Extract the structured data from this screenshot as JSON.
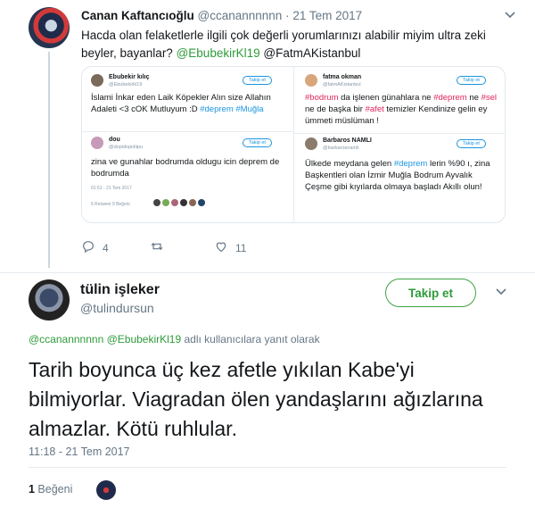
{
  "top_tweet": {
    "author_name": "Canan Kaftancıoğlu",
    "author_handle": "@ccanannnnnn",
    "date": "· 21 Tem 2017",
    "text_1": "Hacda olan felaketlerle ilgili çok değerli yorumlarınızı alabilir miyim ultra zeki beyler, bayanlar?",
    "mention_1": "@EbubekirKl19",
    "mention_2": "@FatmAKistanbul",
    "replies": "4",
    "likes": "11"
  },
  "embedded": {
    "card1": {
      "name": "Ebubekir kılıç",
      "handle": "@Ebubekirkl19",
      "follow": "Takip et",
      "text": "İslami İnkar eden Laik Köpekler Alın size Allahın Adaleti <3 cOK Mutluyum :D",
      "tags": "#deprem #Muğla"
    },
    "card2": {
      "name": "dou",
      "handle": "@dopidopidiipu",
      "follow": "Takip et",
      "text": "zina ve gunahlar bodrumda oldugu icin deprem de bodrumda",
      "meta": "01:51 - 21 Tem 2017",
      "stats": "6 Retweet   9 Beğeni"
    },
    "card3": {
      "name": "fatma okman",
      "handle": "@fatmAKistanbul",
      "follow": "Takip et",
      "tag1": "#bodrum",
      "t1": " da işlenen günahlara ne ",
      "tag2": "#deprem",
      "t2": " ne ",
      "tag3": "#sel",
      "t3": " ne de başka bir ",
      "tag4": "#afet",
      "t4": " temizler Kendinize gelin ey ümmeti müslüman !"
    },
    "card4": {
      "name": "Barbaros NAMLI",
      "handle": "@barbarosnamli",
      "follow": "Takip et",
      "t1": "Ülkede meydana gelen ",
      "tag": "#deprem",
      "t2": " lerin %90 ı, zina Başkentleri olan İzmir Muğla Bodrum Ayvalık Çeşme gibi kıyılarda olmaya başladı Akıllı olun!"
    }
  },
  "main_tweet": {
    "author_name": "tülin işleker",
    "author_handle": "@tulindursun",
    "follow_label": "Takip et",
    "reply_mention_1": "@ccanannnnnn",
    "reply_mention_2": "@EbubekirKl19",
    "reply_suffix": " adlı kullanıcılara yanıt olarak",
    "text": "Tarih boyunca üç kez afetle yıkılan Kabe'yi bilmiyorlar. Viagradan ölen yandaşlarını ağızlarına almazlar. Kötü ruhlular.",
    "timestamp": "11:18 - 21 Tem 2017",
    "like_count": "1",
    "like_label": " Beğeni"
  },
  "icons": [
    "chevron-down-icon",
    "reply-icon",
    "retweet-icon",
    "heart-icon"
  ],
  "colors": {
    "follow_green": "#2e9b3a",
    "link_blue": "#1b95e0",
    "muted": "#657786"
  }
}
